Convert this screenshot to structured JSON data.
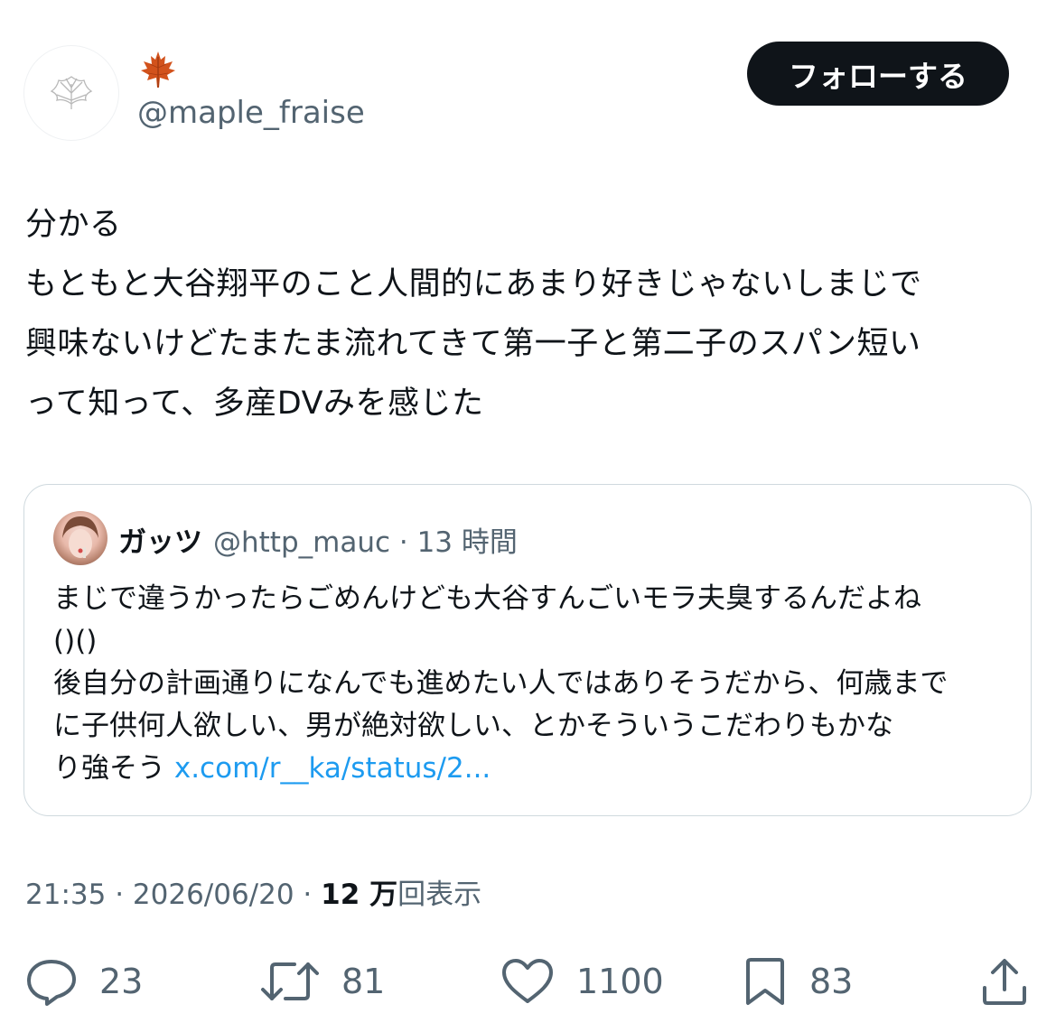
{
  "author": {
    "display_name_emoji": "🍁",
    "handle": "@maple_fraise",
    "avatar_icon": "leaf-icon"
  },
  "follow_button": {
    "label": "フォローする"
  },
  "tweet": {
    "text": "分かる\nもともと大谷翔平のこと人間的にあまり好きじゃないしまじで\n興味ないけどたまたま流れてきて第一子と第二子のスパン短い\nって知って、多産DVみを感じた"
  },
  "quote": {
    "name": "ガッツ",
    "meta": "@http_mauc · 13 時間",
    "text": "まじで違うかったらごめんけども大谷すんごいモラ夫臭するんだよね\n()()\n後自分の計画通りになんでも進めたい人ではありそうだから、何歳まで\nに子供何人欲しい、男が絶対欲しい、とかそういうこだわりもかな\nり強そう ",
    "link": "x.com/r__ka/status/2..."
  },
  "timestamp": {
    "time_date": "21:35 · 2026/06/20 · ",
    "views_count": "12 万",
    "views_label": "回表示"
  },
  "actions": {
    "replies": "23",
    "reposts": "81",
    "likes": "1100",
    "bookmarks": "83"
  }
}
